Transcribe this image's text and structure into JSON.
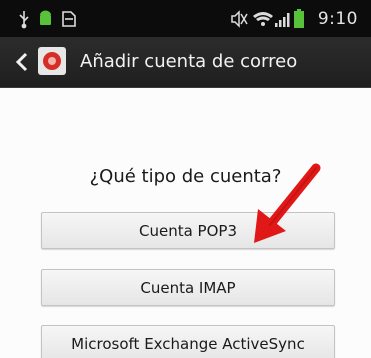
{
  "status_bar": {
    "time": "9:10",
    "icons": [
      "usb-icon",
      "android-icon",
      "sd-card-icon",
      "mute-icon",
      "wifi-icon",
      "signal-icon",
      "battery-icon"
    ]
  },
  "action_bar": {
    "title": "Añadir cuenta de correo",
    "back_icon": "chevron-left-icon",
    "app_icon": "email-app-icon"
  },
  "main": {
    "question": "¿Qué tipo de cuenta?",
    "options": [
      {
        "label": "Cuenta POP3"
      },
      {
        "label": "Cuenta IMAP"
      },
      {
        "label": "Microsoft Exchange ActiveSync"
      }
    ]
  },
  "annotation": {
    "icon": "red-arrow-icon",
    "color": "#e01818"
  },
  "colors": {
    "status_bar": "#0c0c0c",
    "action_bar": "#262626",
    "background": "#fcfcfc",
    "button": "#eeeeee",
    "battery": "#57c23a"
  }
}
